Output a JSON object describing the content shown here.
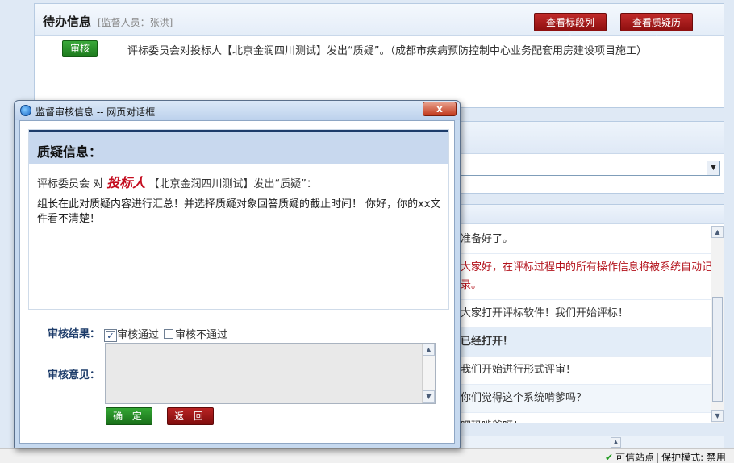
{
  "todo": {
    "title": "待办信息",
    "supervisor": "[监督人员：张洪]",
    "view_sections_button": "查看标段列表",
    "view_history_button": "查看质疑历史",
    "review_button": "审核",
    "message": "评标委员会对投标人【北京金润四川测试】发出“质疑”。（成都市疾病预防控制中心业务配套用房建设项目施工）"
  },
  "chat": {
    "lines": [
      {
        "text": "准备好了。",
        "style": "normal"
      },
      {
        "text": "大家好，在评标过程中的所有操作信息将被系统自动记",
        "style": "red"
      },
      {
        "text": "录。",
        "style": "red"
      },
      {
        "text": "大家打开评标软件！我们开始评标！",
        "style": "normal"
      },
      {
        "text": "已经打开！",
        "style": "hl"
      },
      {
        "text": "我们开始进行形式评审！",
        "style": "normal"
      },
      {
        "text": "你们觉得这个系统啃爹吗？",
        "style": "alt"
      },
      {
        "text": "吧玛啃爹呀！",
        "style": "normal"
      }
    ]
  },
  "statusbar": {
    "trusted": "可信站点",
    "protected": "保护模式: 禁用"
  },
  "dialog": {
    "title": "监督审核信息 -- 网页对话框",
    "close_label": "x",
    "heading": "质疑信息：",
    "line_prefix": "评标委员会 对",
    "bidder_role": "投标人",
    "line_suffix": "【北京金润四川测试】发出“质疑”：",
    "content": "组长在此对质疑内容进行汇总！并选择质疑对象回答质疑的截止时间！ 你好，你的xx文件看不清楚！",
    "result_label": "审核结果：",
    "pass_label": "审核通过",
    "pass_checked": true,
    "fail_label": "审核不通过",
    "fail_checked": false,
    "opinion_label": "审核意见：",
    "opinion_value": "",
    "ok_button": "确 定",
    "back_button": "返 回"
  },
  "icons": {
    "dialog": "ie-page-icon",
    "close": "close-icon",
    "trusted": "check-icon",
    "scroll_up": "scroll-up-icon",
    "scroll_down": "scroll-down-icon",
    "dropdown": "chevron-down-icon"
  },
  "colors": {
    "primary_red": "#a01515",
    "primary_green": "#248a24",
    "accent_navy": "#1d3c6a",
    "bidder_red": "#c40d1f"
  }
}
